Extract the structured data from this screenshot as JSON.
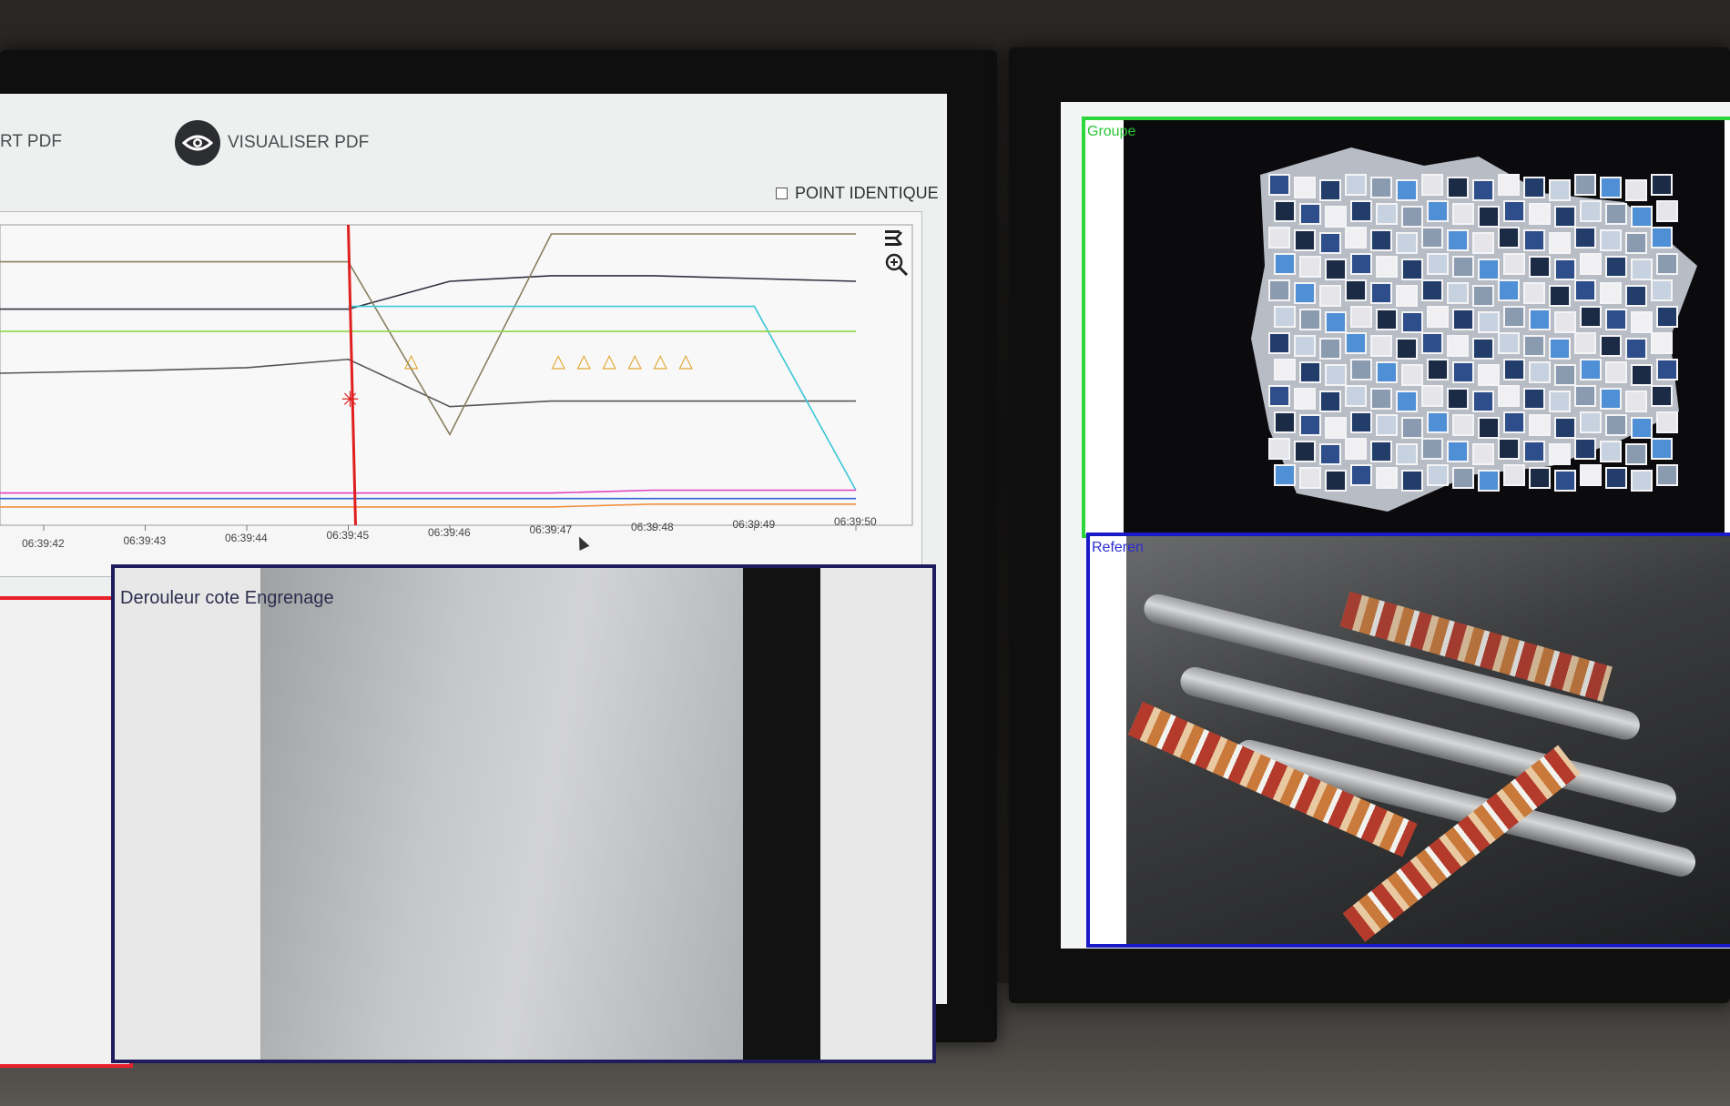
{
  "toolbar": {
    "export_label": "RT PDF",
    "visualiser_label": "VISUALISER PDF",
    "point_identique_label": "POINT IDENTIQUE"
  },
  "chart": {
    "toolbar_icons": [
      "menu-icon",
      "zoom-in-icon"
    ]
  },
  "chart_data": {
    "type": "line",
    "x_ticks": [
      "06:39:42",
      "06:39:43",
      "06:39:44",
      "06:39:45",
      "06:39:46",
      "06:39:47",
      "06:39:48",
      "06:39:49",
      "06:39:50"
    ],
    "event_marker": "06:39:45",
    "series": [
      {
        "color": "#303040",
        "values": [
          0.27,
          0.27,
          0.27,
          0.27,
          0.17,
          0.15,
          0.15,
          0.16,
          0.17
        ]
      },
      {
        "color": "#555555",
        "values": [
          0.5,
          0.49,
          0.48,
          0.45,
          0.62,
          0.6,
          0.6,
          0.6,
          0.6
        ]
      },
      {
        "color": "#888060",
        "values": [
          0.1,
          0.1,
          0.1,
          0.1,
          0.72,
          0.0,
          0.0,
          0.0,
          0.0
        ]
      },
      {
        "color": "#39c6d8",
        "values": [
          null,
          null,
          null,
          0.26,
          0.26,
          0.26,
          0.26,
          0.26,
          0.92
        ]
      },
      {
        "color": "#8fd648",
        "values": [
          0.35,
          0.35,
          0.35,
          0.35,
          0.35,
          0.35,
          0.35,
          0.35,
          0.35
        ]
      },
      {
        "color": "#e040c0",
        "values": [
          0.93,
          0.93,
          0.93,
          0.93,
          0.93,
          0.93,
          0.92,
          0.92,
          0.92
        ]
      },
      {
        "color": "#3060d0",
        "values": [
          0.95,
          0.95,
          0.95,
          0.95,
          0.95,
          0.95,
          0.95,
          0.95,
          0.95
        ]
      },
      {
        "color": "#f09040",
        "values": [
          0.98,
          0.98,
          0.98,
          0.98,
          0.98,
          0.98,
          0.97,
          0.97,
          0.97
        ]
      }
    ],
    "warnings_count": 7,
    "xlabel": "",
    "ylabel": ""
  },
  "cameras": {
    "derouleur_label": "Derouleur cote Engrenage",
    "groupe_label": "Groupe",
    "reference_label": "Referen"
  },
  "colors": {
    "red_frame": "#e8202a",
    "navy_frame": "#201a5e",
    "green_frame": "#2ad63a",
    "blue_frame": "#1a1ac9",
    "marker": "#e02020"
  }
}
